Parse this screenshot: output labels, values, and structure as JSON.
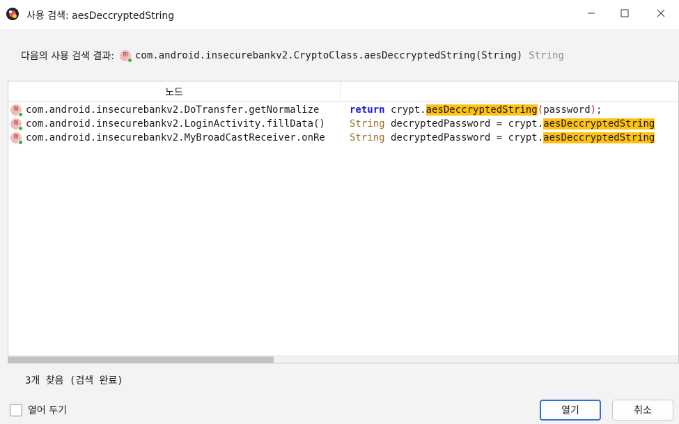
{
  "window": {
    "title": "사용 검색: aesDeccryptedString"
  },
  "header": {
    "label": "다음의 사용 검색 결과:",
    "signature": "com.android.insecurebankv2.CryptoClass.aesDeccryptedString(String)",
    "return_type": "String"
  },
  "table": {
    "column_node": "노드",
    "column_code": "",
    "rows": [
      {
        "icon": "method-icon",
        "node": "com.android.insecurebankv2.DoTransfer.getNormalize",
        "code_prefix_kw": "return",
        "code_mid": " crypt.",
        "code_highlight": "aesDeccryptedString",
        "code_open_paren": "(",
        "code_tail": "password",
        "code_close_paren": ")",
        "code_end": ";"
      },
      {
        "icon": "method-icon",
        "node": "com.android.insecurebankv2.LoginActivity.fillData()",
        "code_type": "String",
        "code_mid": " decryptedPassword = crypt.",
        "code_highlight": "aesDeccryptedString"
      },
      {
        "icon": "method-icon",
        "node": "com.android.insecurebankv2.MyBroadCastReceiver.onRe",
        "code_type": "String",
        "code_mid": " decryptedPassword = crypt.",
        "code_highlight": "aesDeccryptedString"
      }
    ]
  },
  "status": "3개 찾음 (검색 완료)",
  "footer": {
    "keep_open_label": "열어 두기",
    "keep_open_checked": false,
    "open_button": "열기",
    "cancel_button": "취소"
  },
  "icons": {
    "method": "m",
    "app": "jadx-icon"
  },
  "colors": {
    "highlight": "#ffc20e",
    "keyword": "#1a1ad8",
    "type": "#9b7420",
    "default_button_border": "#2f6fd1"
  }
}
